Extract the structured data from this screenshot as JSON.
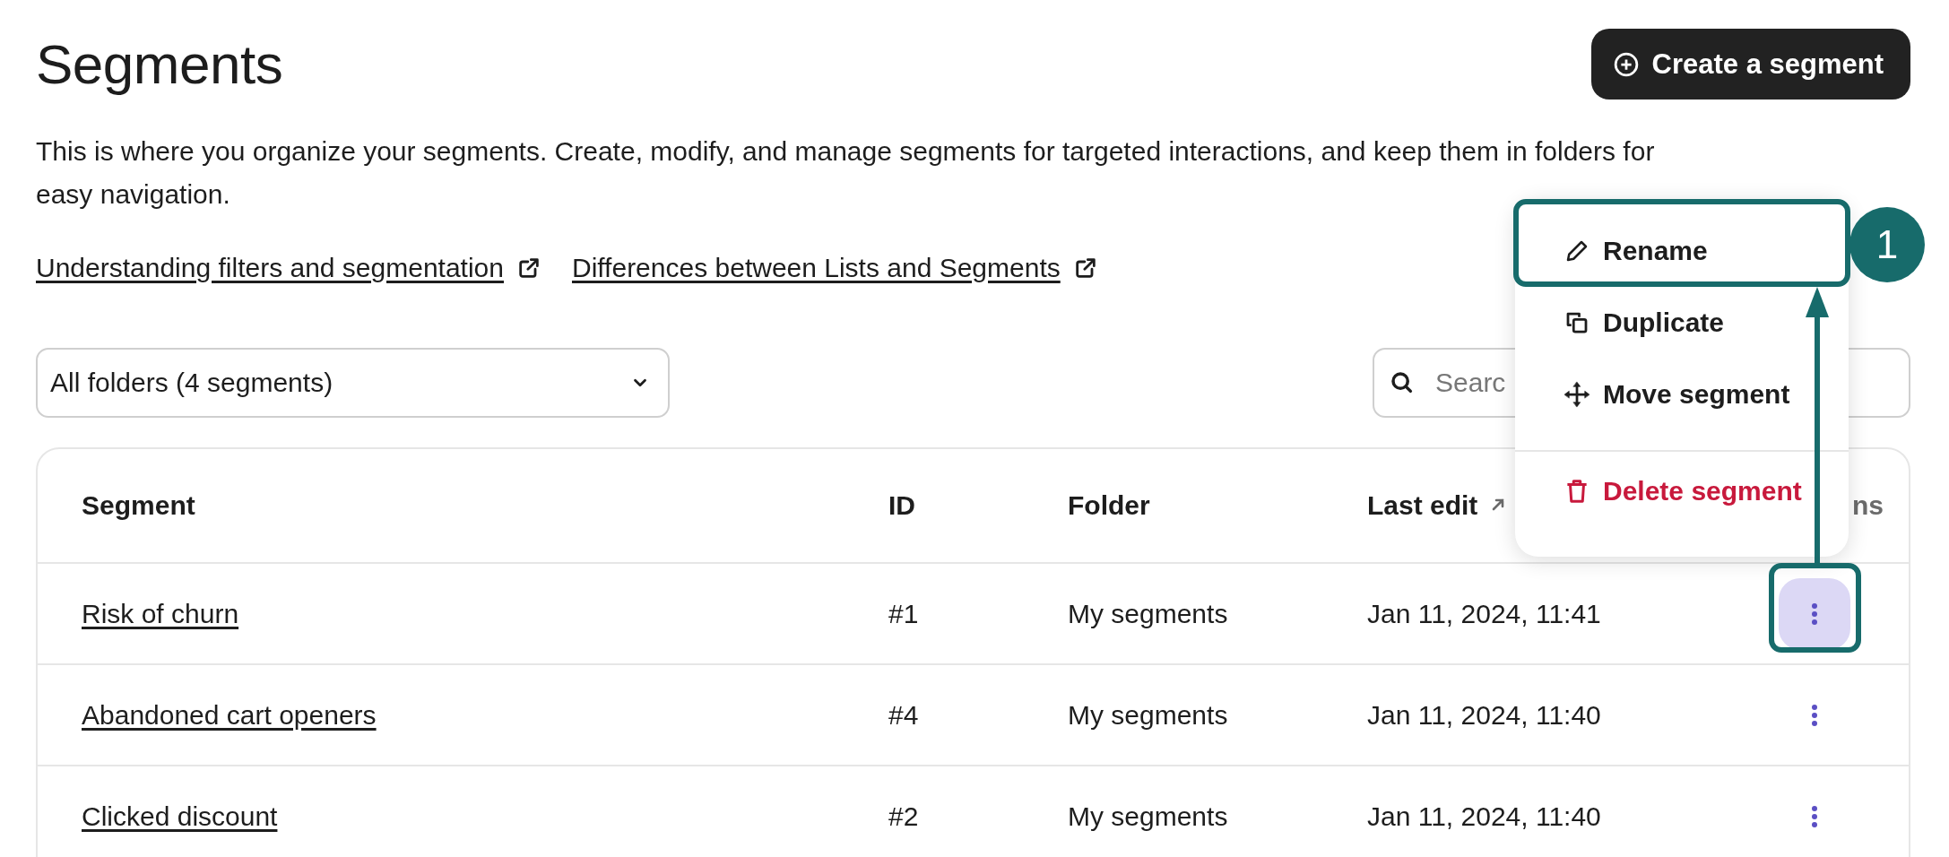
{
  "page": {
    "title": "Segments",
    "create_button": "Create a segment",
    "description": "This is where you organize your segments. Create, modify, and manage segments for targeted interactions, and keep them in folders for easy navigation.",
    "links": [
      {
        "label": "Understanding filters and segmentation"
      },
      {
        "label": "Differences between Lists and Segments"
      }
    ]
  },
  "folder_select": {
    "value": "All folders (4 segments)"
  },
  "search": {
    "placeholder": "Searc"
  },
  "table": {
    "columns": [
      {
        "label": "Segment",
        "sorted": false
      },
      {
        "label": "ID",
        "sorted": false
      },
      {
        "label": "Folder",
        "sorted": false
      },
      {
        "label": "Last edit",
        "sorted": true
      },
      {
        "label": "ns",
        "sorted": false
      }
    ],
    "rows": [
      {
        "name": "Risk of churn",
        "id": "#1",
        "folder": "My segments",
        "last_edit": "Jan 11, 2024, 11:41",
        "menu_open": true
      },
      {
        "name": "Abandoned cart openers",
        "id": "#4",
        "folder": "My segments",
        "last_edit": "Jan 11, 2024, 11:40",
        "menu_open": false
      },
      {
        "name": "Clicked discount",
        "id": "#2",
        "folder": "My segments",
        "last_edit": "Jan 11, 2024, 11:40",
        "menu_open": false
      }
    ]
  },
  "row_menu": {
    "items": [
      {
        "label": "Rename",
        "kind": "normal"
      },
      {
        "label": "Duplicate",
        "kind": "normal"
      },
      {
        "label": "Move segment",
        "kind": "normal"
      },
      {
        "label": "Delete segment",
        "kind": "danger"
      }
    ]
  },
  "callout": {
    "number": "1"
  }
}
